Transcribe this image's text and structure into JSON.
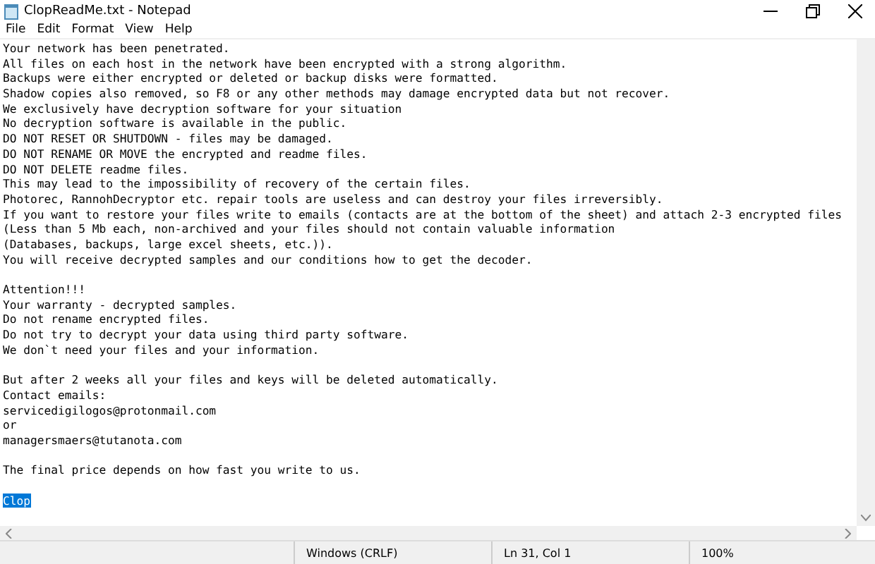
{
  "window": {
    "title": "ClopReadMe.txt - Notepad"
  },
  "menu": [
    "File",
    "Edit",
    "Format",
    "View",
    "Help"
  ],
  "document": {
    "paragraphs": [
      {
        "selected": false,
        "lines": [
          "Your network has been penetrated.",
          "All files on each host in the network have been encrypted with a strong algorithm.",
          "Backups were either encrypted or deleted or backup disks were formatted.",
          "Shadow copies also removed, so F8 or any other methods may damage encrypted data but not recover.",
          "We exclusively have decryption software for your situation",
          "No decryption software is available in the public.",
          "DO NOT RESET OR SHUTDOWN - files may be damaged.",
          "DO NOT RENAME OR MOVE the encrypted and readme files.",
          "DO NOT DELETE readme files.",
          "This may lead to the impossibility of recovery of the certain files.",
          "Photorec, RannohDecryptor etc. repair tools are useless and can destroy your files irreversibly.",
          "If you want to restore your files write to emails (contacts are at the bottom of the sheet) and attach 2-3 encrypted files",
          "(Less than 5 Mb each, non-archived and your files should not contain valuable information",
          "(Databases, backups, large excel sheets, etc.)).",
          "You will receive decrypted samples and our conditions how to get the decoder."
        ]
      },
      {
        "selected": false,
        "lines": [
          "Attention!!!",
          "Your warranty - decrypted samples.",
          "Do not rename encrypted files.",
          "Do not try to decrypt your data using third party software.",
          "We don`t need your files and your information."
        ]
      },
      {
        "selected": false,
        "lines": [
          "But after 2 weeks all your files and keys will be deleted automatically.",
          "Contact emails:",
          "servicedigilogos@protonmail.com",
          "or",
          "managersmaers@tutanota.com"
        ]
      },
      {
        "selected": false,
        "lines": [
          "The final price depends on how fast you write to us."
        ]
      },
      {
        "selected": true,
        "lines": [
          "Clop"
        ]
      }
    ]
  },
  "status_bar": {
    "line_ending": "Windows (CRLF)",
    "position": "Ln 31, Col 1",
    "zoom": "100%"
  }
}
